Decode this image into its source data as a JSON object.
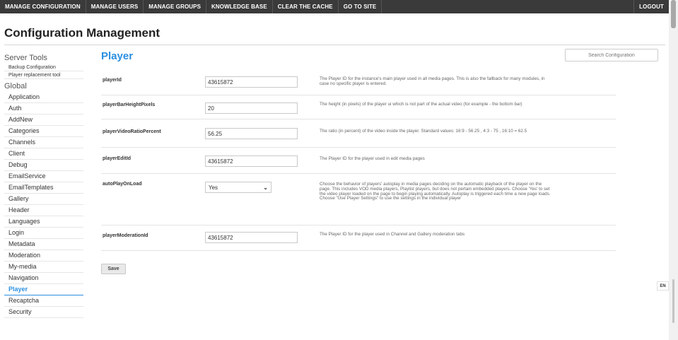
{
  "nav": {
    "items": [
      "MANAGE CONFIGURATION",
      "MANAGE USERS",
      "MANAGE GROUPS",
      "KNOWLEDGE BASE",
      "CLEAR THE CACHE",
      "GO TO SITE"
    ],
    "logout": "LOGOUT"
  },
  "page_title": "Configuration Management",
  "sidebar": {
    "server_tools_title": "Server Tools",
    "tools": [
      "Backup Configuration",
      "Player replacement tool"
    ],
    "global_title": "Global",
    "items": [
      "Application",
      "Auth",
      "AddNew",
      "Categories",
      "Channels",
      "Client",
      "Debug",
      "EmailService",
      "EmailTemplates",
      "Gallery",
      "Header",
      "Languages",
      "Login",
      "Metadata",
      "Moderation",
      "My-media",
      "Navigation",
      "Player",
      "Recaptcha",
      "Security"
    ],
    "active": "Player"
  },
  "main": {
    "section_title": "Player",
    "search_placeholder": "Search Configuration",
    "fields": [
      {
        "label": "playerId",
        "value": "43615872",
        "description": "The Player ID for the instance's main player used in all media pages. This is also the fallback for many modules, in case no specific player is entered."
      },
      {
        "label": "playerBarHeightPixels",
        "value": "20",
        "description": "The height (in pixels) of the player ui which is not part of the actual video (for example - the bottom bar)"
      },
      {
        "label": "playerVideoRatioPercent",
        "value": "56.25",
        "description": "The ratio (in percent) of the video inside the player. Standard values: 16:9 - 56.25 , 4:3 - 75 , 16:10 = 62.5"
      },
      {
        "label": "playerEditId",
        "value": "43615872",
        "description": "The Player ID for the player used in edit media pages"
      },
      {
        "label": "autoPlayOnLoad",
        "value": "Yes",
        "description": "Choose the behavior of players' autoplay in media pages deciding on the automatic playback of the player on the page. This includes VOD media players, Playlist players, but does not pertain embedded players. Choose 'Yes' to set the video player loaded on the page to begin playing automatically. Autoplay is triggered each time a new page loads. Choose \"Use Player Settings\" to use the settings in the individual player"
      },
      {
        "label": "playerModerationId",
        "value": "43615872",
        "description": "The Player ID for the player used in Channel and Gallery moderation tabs"
      }
    ],
    "save_label": "Save"
  },
  "lang_badge": "EN",
  "colors": {
    "accent": "#2a8fe0",
    "topbar": "#3a3a3a"
  }
}
